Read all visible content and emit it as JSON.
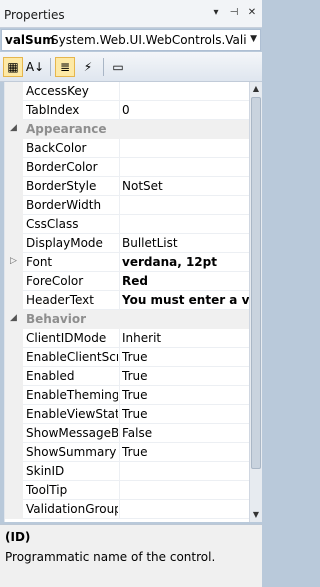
{
  "window": {
    "title": "Properties",
    "icons": [
      "dropdown-icon",
      "pin-icon",
      "close-icon"
    ]
  },
  "object_selector": {
    "name": "valSum",
    "type": "System.Web.UI.WebControls.ValidationSummary"
  },
  "toolbar": {
    "buttons": [
      {
        "name": "categorized-button",
        "glyph": "▦",
        "active": true
      },
      {
        "name": "alphabetical-button",
        "glyph": "A↓",
        "active": false
      },
      {
        "name": "properties-button",
        "glyph": "≣",
        "active": true
      },
      {
        "name": "events-button",
        "glyph": "⚡",
        "active": false
      },
      {
        "name": "property-pages-button",
        "glyph": "▭",
        "active": false
      }
    ]
  },
  "grid": {
    "rows": [
      {
        "kind": "prop",
        "name": "AccessKey",
        "value": ""
      },
      {
        "kind": "prop",
        "name": "TabIndex",
        "value": "0"
      },
      {
        "kind": "cat",
        "name": "Appearance"
      },
      {
        "kind": "prop",
        "name": "BackColor",
        "value": ""
      },
      {
        "kind": "prop",
        "name": "BorderColor",
        "value": ""
      },
      {
        "kind": "prop",
        "name": "BorderStyle",
        "value": "NotSet"
      },
      {
        "kind": "prop",
        "name": "BorderWidth",
        "value": ""
      },
      {
        "kind": "prop",
        "name": "CssClass",
        "value": ""
      },
      {
        "kind": "prop",
        "name": "DisplayMode",
        "value": "BulletList"
      },
      {
        "kind": "prop",
        "name": "Font",
        "value": "verdana, 12pt",
        "bold": true,
        "expandable": true
      },
      {
        "kind": "prop",
        "name": "ForeColor",
        "value": "Red",
        "bold": true
      },
      {
        "kind": "prop",
        "name": "HeaderText",
        "value": "You must enter a value",
        "bold": true
      },
      {
        "kind": "cat",
        "name": "Behavior"
      },
      {
        "kind": "prop",
        "name": "ClientIDMode",
        "value": "Inherit"
      },
      {
        "kind": "prop",
        "name": "EnableClientScript",
        "value": "True"
      },
      {
        "kind": "prop",
        "name": "Enabled",
        "value": "True"
      },
      {
        "kind": "prop",
        "name": "EnableTheming",
        "value": "True"
      },
      {
        "kind": "prop",
        "name": "EnableViewState",
        "value": "True"
      },
      {
        "kind": "prop",
        "name": "ShowMessageBox",
        "value": "False"
      },
      {
        "kind": "prop",
        "name": "ShowSummary",
        "value": "True"
      },
      {
        "kind": "prop",
        "name": "SkinID",
        "value": ""
      },
      {
        "kind": "prop",
        "name": "ToolTip",
        "value": ""
      },
      {
        "kind": "prop",
        "name": "ValidationGroup",
        "value": ""
      }
    ]
  },
  "description": {
    "title": "(ID)",
    "text": "Programmatic name of the control."
  },
  "colors": {
    "frame": "#b9c9da",
    "category_label": "#8e8e8e",
    "active_button": "#fde9a6"
  }
}
